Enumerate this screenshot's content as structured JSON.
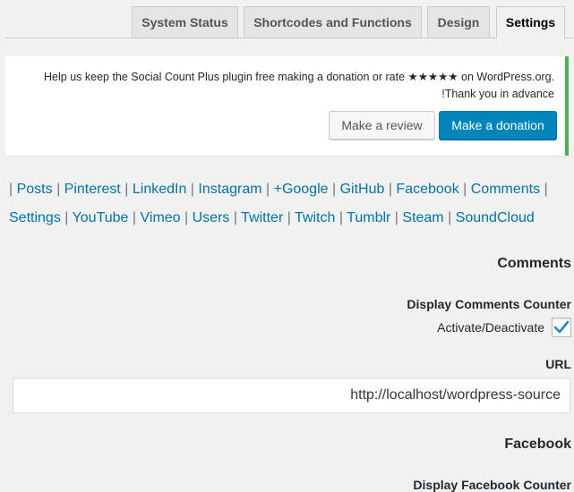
{
  "tabs": [
    {
      "label": "System Status"
    },
    {
      "label": "Shortcodes and Functions"
    },
    {
      "label": "Design"
    },
    {
      "label": "Settings",
      "active": true
    }
  ],
  "notice": {
    "line1": "Help us keep the Social Count Plus plugin free making a donation or rate ★★★★★ on WordPress.org.",
    "line2": "!Thank you in advance",
    "review_button": "Make a review",
    "donation_button": "Make a donation"
  },
  "network_links": {
    "separator": "|",
    "items": [
      "Posts",
      "Pinterest",
      "LinkedIn",
      "Instagram",
      "+Google",
      "GitHub",
      "Facebook",
      "Comments",
      "Settings",
      "YouTube",
      "Vimeo",
      "Users",
      "Twitter",
      "Twitch",
      "Tumblr",
      "Steam",
      "SoundCloud"
    ]
  },
  "comments_section": {
    "title": "Comments",
    "counter_label": "Display Comments Counter",
    "activate_label": "Activate/Deactivate",
    "activate_checked": true,
    "url_label": "URL",
    "url_value": "http://localhost/wordpress-source"
  },
  "facebook_section": {
    "title": "Facebook",
    "counter_label": "Display Facebook Counter"
  },
  "colors": {
    "link": "#0073aa",
    "primary_button": "#0085ba",
    "notice_border": "#46b450",
    "checkmark": "#1e8cbe"
  }
}
